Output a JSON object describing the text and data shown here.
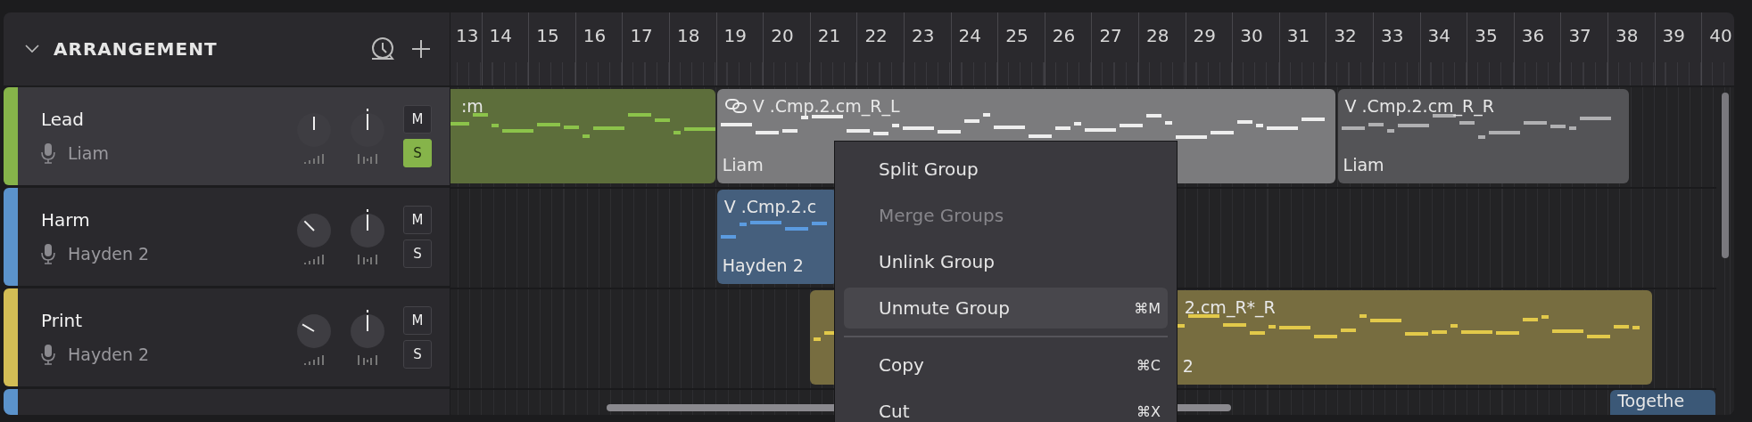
{
  "header": {
    "title": "ARRANGEMENT"
  },
  "ruler": [
    "13",
    "14",
    "15",
    "16",
    "17",
    "18",
    "19",
    "20",
    "21",
    "22",
    "23",
    "24",
    "25",
    "26",
    "27",
    "28",
    "29",
    "30",
    "31",
    "32",
    "33",
    "34",
    "35",
    "36",
    "37",
    "38",
    "39",
    "40"
  ],
  "tracks": [
    {
      "name": "Lead",
      "singer": "Liam",
      "color": "#86b44a",
      "selected": true,
      "volume": {
        "level": 0.5
      },
      "pan": {
        "level": 0.5
      },
      "mute": {
        "label": "M",
        "on": false
      },
      "solo": {
        "label": "S",
        "on": true
      }
    },
    {
      "name": "Harm",
      "singer": "Hayden 2",
      "color": "#5b93cc",
      "selected": false,
      "volume": {
        "level": 0.333
      },
      "pan": {
        "level": 0.5
      },
      "mute": {
        "label": "M",
        "on": false
      },
      "solo": {
        "label": "S",
        "on": false
      }
    },
    {
      "name": "Print",
      "singer": "Hayden 2",
      "color": "#d3bd55",
      "selected": false,
      "volume": {
        "level": 0.278
      },
      "pan": {
        "level": 0.5
      },
      "mute": {
        "label": "M",
        "on": false
      },
      "solo": {
        "label": "S",
        "on": false
      }
    }
  ],
  "partial_track": {
    "color": "#5b93cc"
  },
  "clips": [
    {
      "title": ":m",
      "color": "#5d6e3b",
      "linked": false
    },
    {
      "title": "V .Cmp.2.cm_R_L",
      "singer": "Liam",
      "color": "#7b7b7d",
      "linked": true
    },
    {
      "title": "V .Cmp.2.cm_R_R",
      "singer": "Liam",
      "color": "#545457",
      "linked": false
    },
    {
      "title": "V .Cmp.2.c",
      "singer": "Hayden 2",
      "color": "#455f7d",
      "linked": false
    },
    {
      "title": "2.cm_R*_R",
      "singer": "2",
      "color": "#776d40",
      "linked": false
    },
    {
      "title": "Togethe",
      "color": "#3b5877",
      "linked": false
    }
  ],
  "context_menu": {
    "items": [
      {
        "kind": "item",
        "label": "Split Group",
        "disabled": false,
        "selected": false
      },
      {
        "kind": "item",
        "label": "Merge Groups",
        "disabled": true,
        "selected": false
      },
      {
        "kind": "item",
        "label": "Unlink Group",
        "disabled": false,
        "selected": false
      },
      {
        "kind": "item",
        "label": "Unmute Group",
        "shortcut": "⌘M",
        "disabled": false,
        "selected": true
      },
      {
        "kind": "separator"
      },
      {
        "kind": "item",
        "label": "Copy",
        "shortcut": "⌘C",
        "disabled": false,
        "selected": false
      },
      {
        "kind": "item",
        "label": "Cut",
        "shortcut": "⌘X",
        "disabled": false,
        "selected": false
      }
    ]
  }
}
